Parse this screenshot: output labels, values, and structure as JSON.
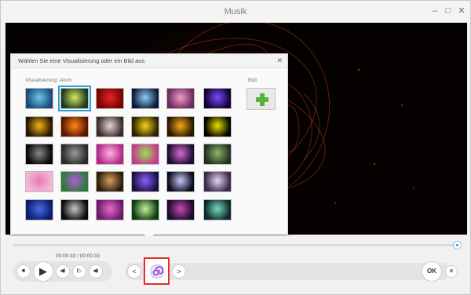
{
  "window": {
    "title": "Musik",
    "minimize_glyph": "–",
    "maximize_glyph": "□",
    "close_glyph": "✕"
  },
  "popup": {
    "title": "Wählen Sie eine Visualisierung oder ein Bild aus",
    "close_glyph": "✕",
    "visualization_label": "Visualisierung: Atom",
    "image_label": "Bild",
    "selected_index": 1,
    "thumbnails": [
      {
        "name": "teal-storm",
        "colors": [
          "#1a4a7a",
          "#6cc7e8"
        ]
      },
      {
        "name": "atom",
        "colors": [
          "#1b3a22",
          "#d9e85a"
        ]
      },
      {
        "name": "red-glow",
        "colors": [
          "#7a0000",
          "#e4262c"
        ]
      },
      {
        "name": "blue-rays",
        "colors": [
          "#0c1a3a",
          "#8ad0f5"
        ]
      },
      {
        "name": "pink-crystals",
        "colors": [
          "#6b2a60",
          "#f39cc1"
        ]
      },
      {
        "name": "purple-orbit",
        "colors": [
          "#120033",
          "#7a4bff"
        ]
      },
      {
        "name": "gold-sparks",
        "colors": [
          "#241400",
          "#f2b318"
        ]
      },
      {
        "name": "fire-burst",
        "colors": [
          "#5a1500",
          "#ff8a18"
        ]
      },
      {
        "name": "piano-keys",
        "colors": [
          "#3b2a2a",
          "#e6d8d8"
        ]
      },
      {
        "name": "yellow-lines",
        "colors": [
          "#2a2200",
          "#f5d21c"
        ]
      },
      {
        "name": "gold-figure",
        "colors": [
          "#2a1800",
          "#f0a818"
        ]
      },
      {
        "name": "stick-figure",
        "colors": [
          "#000000",
          "#e8e000"
        ]
      },
      {
        "name": "network",
        "colors": [
          "#050505",
          "#8a8a8a"
        ]
      },
      {
        "name": "vortex",
        "colors": [
          "#2a2a2a",
          "#9a9a9a"
        ]
      },
      {
        "name": "pink-swirl",
        "colors": [
          "#b4268a",
          "#ffb4e0"
        ]
      },
      {
        "name": "green-ring",
        "colors": [
          "#c43a8a",
          "#98e05a"
        ]
      },
      {
        "name": "purple-bokeh",
        "colors": [
          "#1a0e33",
          "#d86ad0"
        ]
      },
      {
        "name": "green-bokeh",
        "colors": [
          "#223022",
          "#8ab86a"
        ]
      },
      {
        "name": "pink-waves",
        "colors": [
          "#f4b8d4",
          "#e87ab4"
        ]
      },
      {
        "name": "green-purple",
        "colors": [
          "#2a7a3a",
          "#b65ad8"
        ]
      },
      {
        "name": "bronze-circle",
        "colors": [
          "#2a1a0a",
          "#d8a064"
        ]
      },
      {
        "name": "violet-streak",
        "colors": [
          "#1a1040",
          "#8a60ff"
        ]
      },
      {
        "name": "grid-tunnel",
        "colors": [
          "#0a0a1a",
          "#c8c8ff"
        ]
      },
      {
        "name": "lilac-haze",
        "colors": [
          "#3a2a4a",
          "#e4d4f0"
        ]
      },
      {
        "name": "blue-deep",
        "colors": [
          "#0a1a6a",
          "#4a6ae8"
        ]
      },
      {
        "name": "disc",
        "colors": [
          "#0a0a0a",
          "#c8c8c8"
        ]
      },
      {
        "name": "magenta-flow",
        "colors": [
          "#6a1a6a",
          "#e86ad0"
        ]
      },
      {
        "name": "green-burst",
        "colors": [
          "#0a3a0a",
          "#c8f0a0"
        ]
      },
      {
        "name": "purple-wave",
        "colors": [
          "#1a0a2a",
          "#c84ab4"
        ]
      },
      {
        "name": "aqua-smoke",
        "colors": [
          "#0a2a2a",
          "#7ad8c0"
        ]
      }
    ]
  },
  "player": {
    "time": "00:00:33 / 00:00:33",
    "seek_progress": 1.0,
    "stop_glyph": "■",
    "play_glyph": "▶",
    "prev_glyph": "◀I",
    "next_glyph": "I▷",
    "volume_glyph": "◀I",
    "back_glyph": "<",
    "forward_glyph": ">",
    "ok_label": "OK",
    "cancel_glyph": "✕"
  }
}
